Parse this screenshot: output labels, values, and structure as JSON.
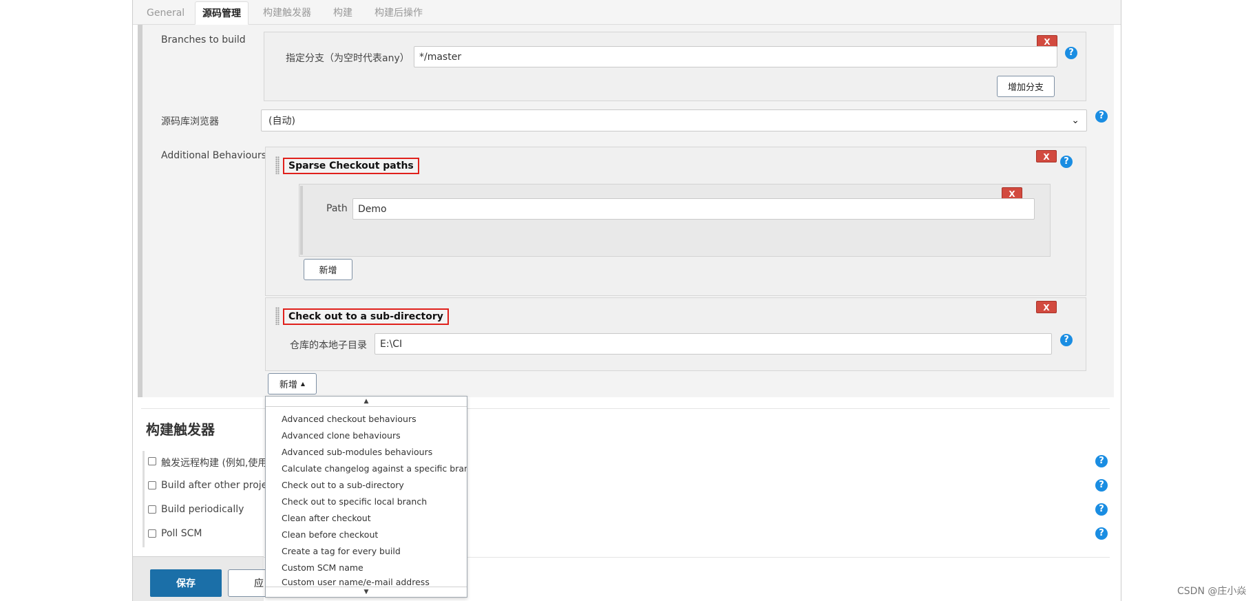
{
  "tabs": [
    "General",
    "源码管理",
    "构建触发器",
    "构建",
    "构建后操作"
  ],
  "branches": {
    "label": "Branches to build",
    "field_label": "指定分支（为空时代表any）",
    "value": "*/master",
    "add_button": "增加分支"
  },
  "browser": {
    "label": "源码库浏览器",
    "value": "(自动)"
  },
  "behaviours": {
    "label": "Additional Behaviours",
    "sparse": {
      "title": "Sparse Checkout paths",
      "path_label": "Path",
      "path_value": "Demo",
      "add_button": "新增"
    },
    "subdir": {
      "title": "Check out to a sub-directory",
      "field_label": "仓库的本地子目录",
      "value": "E:\\CI"
    },
    "add_button": "新增"
  },
  "common": {
    "remove": "X",
    "help": "?"
  },
  "dropdown": {
    "up_arrow": "▲",
    "down_arrow": "▼",
    "items": [
      "Advanced checkout behaviours",
      "Advanced clone behaviours",
      "Advanced sub-modules behaviours",
      "Calculate changelog against a specific branch",
      "Check out to a sub-directory",
      "Check out to specific local branch",
      "Clean after checkout",
      "Clean before checkout",
      "Create a tag for every build",
      "Custom SCM name",
      "Custom user name/e-mail address"
    ]
  },
  "triggers": {
    "title": "构建触发器",
    "items": [
      "触发远程构建 (例如,使用",
      "Build after other projects",
      "Build periodically",
      "Poll SCM"
    ]
  },
  "footer": {
    "save": "保存",
    "apply": "应"
  },
  "watermark": "CSDN @庄小焱"
}
